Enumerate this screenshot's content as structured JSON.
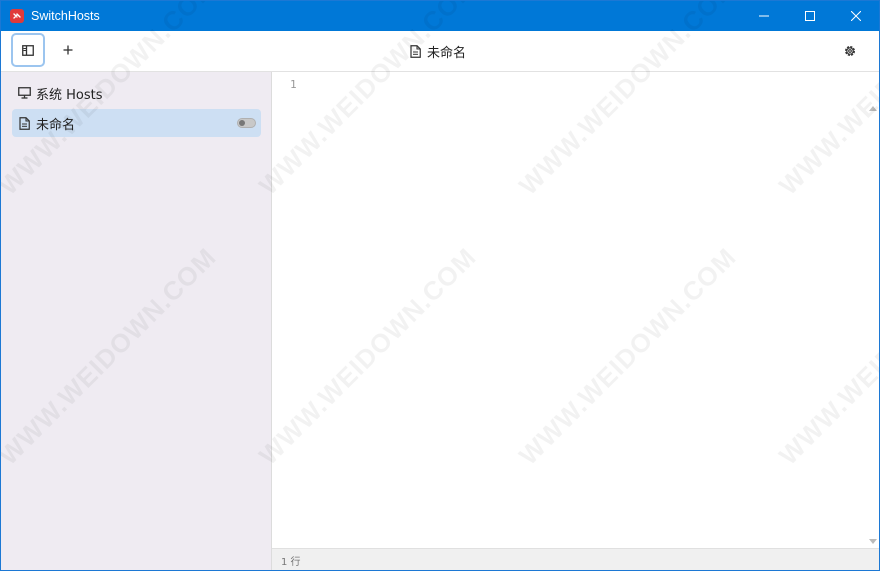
{
  "window": {
    "title": "SwitchHosts",
    "controls": [
      "minimize",
      "maximize",
      "close"
    ]
  },
  "toolbar": {
    "current_title": "未命名"
  },
  "sidebar": {
    "items": [
      {
        "label": "系统 Hosts",
        "icon": "monitor-icon",
        "active": false
      },
      {
        "label": "未命名",
        "icon": "file-icon",
        "active": true,
        "toggle_on": false
      }
    ]
  },
  "editor": {
    "line_numbers": [
      "1"
    ]
  },
  "status": {
    "text": "1 行"
  },
  "watermark": {
    "text": "WWW.WEIDOWN.COM"
  },
  "colors": {
    "titlebar": "#0078d7",
    "sidebar_bg": "#efebf2",
    "active_item": "#cddff3",
    "accent_border": "#9cc5ef"
  }
}
